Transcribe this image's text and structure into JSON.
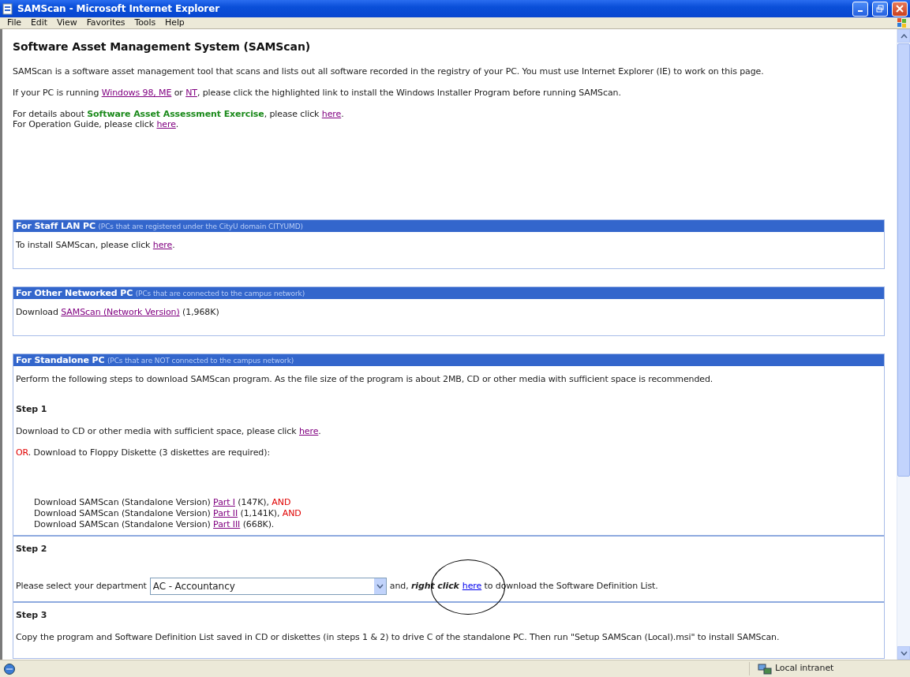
{
  "window": {
    "title": "SAMScan - Microsoft Internet Explorer"
  },
  "menu": [
    "File",
    "Edit",
    "View",
    "Favorites",
    "Tools",
    "Help"
  ],
  "heading": "Software Asset Management System (SAMScan)",
  "intro": [
    [
      [
        {
          "kind": "plain",
          "text": "SAMScan is a software asset management tool that scans and lists out all software recorded in the registry of your PC. You must use Internet Explorer (IE) to work on this page."
        }
      ]
    ],
    [
      [
        {
          "kind": "plain",
          "text": "If your PC is running "
        },
        {
          "kind": "link",
          "text": "Windows 98, ME",
          "visited": true
        },
        {
          "kind": "plain",
          "text": " or "
        },
        {
          "kind": "link",
          "text": "NT",
          "visited": true
        },
        {
          "kind": "plain",
          "text": ", please click the highlighted link to install the Windows Installer Program before running SAMScan."
        }
      ]
    ],
    [
      [
        {
          "kind": "plain",
          "text": "For details about "
        },
        {
          "kind": "highlight",
          "text": "Software Asset Assessment Exercise"
        },
        {
          "kind": "plain",
          "text": ", please click "
        },
        {
          "kind": "link",
          "text": "here",
          "visited": true
        },
        {
          "kind": "plain",
          "text": "."
        }
      ],
      [
        {
          "kind": "plain",
          "text": "For Operation Guide, please click "
        },
        {
          "kind": "link",
          "text": "here",
          "visited": true
        },
        {
          "kind": "plain",
          "text": "."
        }
      ]
    ]
  ],
  "sections": [
    {
      "title": "For Staff LAN PC",
      "subtitle": "(PCs that are registered under the CityU domain CITYUMD)",
      "paragraphs": [
        [
          {
            "kind": "plain",
            "text": "To install SAMScan, please click "
          },
          {
            "kind": "link",
            "text": "here",
            "visited": true
          },
          {
            "kind": "plain",
            "text": "."
          }
        ]
      ]
    },
    {
      "title": "For Other Networked PC",
      "subtitle": "(PCs that are connected to the campus network)",
      "paragraphs": [
        [
          {
            "kind": "plain",
            "text": "Download "
          },
          {
            "kind": "link",
            "text": "SAMScan (Network Version)",
            "visited": true
          },
          {
            "kind": "plain",
            "text": " (1,968K)"
          }
        ]
      ]
    },
    {
      "title": "For Standalone PC",
      "subtitle": "(PCs that are NOT connected to the campus network)",
      "paragraphs": [
        [
          {
            "kind": "plain",
            "text": "Perform the following steps to download SAMScan program. As the file size of the program is about 2MB, CD or other media with sufficient space is recommended."
          }
        ]
      ],
      "steps": [
        {
          "label": "Step 1",
          "blocks": [
            {
              "kind": "para",
              "segments": [
                {
                  "kind": "plain",
                  "text": "Download to CD or other media with sufficient space, please click "
                },
                {
                  "kind": "link",
                  "text": "here",
                  "visited": true
                },
                {
                  "kind": "plain",
                  "text": "."
                }
              ]
            },
            {
              "kind": "para",
              "segments": [
                {
                  "kind": "alert",
                  "text": "OR"
                },
                {
                  "kind": "plain",
                  "text": ". Download to Floppy Diskette (3 diskettes are required):"
                }
              ]
            },
            {
              "kind": "list",
              "lines": [
                [
                  {
                    "kind": "plain",
                    "text": "Download SAMScan (Standalone Version) "
                  },
                  {
                    "kind": "link",
                    "text": "Part I",
                    "visited": true
                  },
                  {
                    "kind": "plain",
                    "text": " (147K), "
                  },
                  {
                    "kind": "alert",
                    "text": "AND"
                  }
                ],
                [
                  {
                    "kind": "plain",
                    "text": "Download SAMScan (Standalone Version) "
                  },
                  {
                    "kind": "link",
                    "text": "Part II",
                    "visited": true
                  },
                  {
                    "kind": "plain",
                    "text": " (1,141K), "
                  },
                  {
                    "kind": "alert",
                    "text": "AND"
                  }
                ],
                [
                  {
                    "kind": "plain",
                    "text": "Download SAMScan (Standalone Version) "
                  },
                  {
                    "kind": "link",
                    "text": "Part III",
                    "visited": true
                  },
                  {
                    "kind": "plain",
                    "text": " (668K)."
                  }
                ]
              ]
            }
          ]
        },
        {
          "label": "Step 2",
          "blocks": [
            {
              "kind": "form",
              "label": "Please select your department",
              "select": {
                "value": "AC - Accountancy"
              },
              "segments": [
                {
                  "kind": "plain",
                  "text": "and, "
                },
                {
                  "kind": "emphasis",
                  "text": "right click"
                },
                {
                  "kind": "link",
                  "text": "here",
                  "visited": false,
                  "circled": true
                },
                {
                  "kind": "plain",
                  "text": " to download the Software Definition List."
                }
              ]
            }
          ]
        },
        {
          "label": "Step 3",
          "blocks": [
            {
              "kind": "para",
              "segments": [
                {
                  "kind": "plain",
                  "text": "Copy the program and Software Definition List saved in CD or diskettes (in steps 1 & 2) to drive C of the standalone PC. Then run \"Setup SAMScan (Local).msi\" to install SAMScan."
                }
              ]
            }
          ]
        }
      ]
    }
  ],
  "status_bar": {
    "zone": "Local intranet"
  }
}
